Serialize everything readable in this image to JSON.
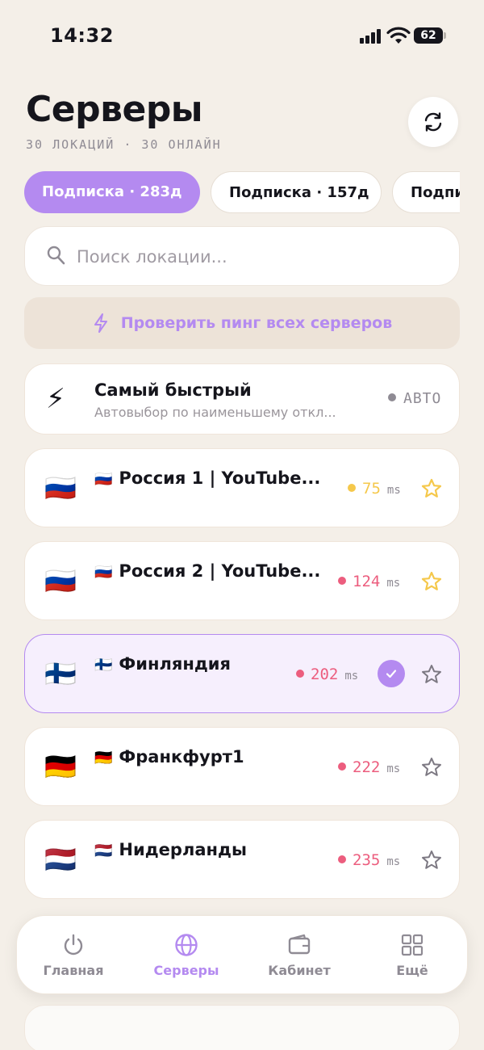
{
  "status_bar": {
    "time": "14:32",
    "battery": "62"
  },
  "header": {
    "title": "Серверы",
    "subtitle": "30 ЛОКАЦИЙ · 30 ОНЛАЙН"
  },
  "subscriptions": [
    {
      "label": "Подписка · 283д",
      "active": true
    },
    {
      "label": "Подписка · 157д",
      "active": false
    },
    {
      "label": "Подписка",
      "active": false
    }
  ],
  "search": {
    "placeholder": "Поиск локации...",
    "value": ""
  },
  "ping_all_label": "Проверить пинг всех серверов",
  "auto_server": {
    "title": "Самый быстрый",
    "description": "Автовыбор по наименьшему откл...",
    "badge": "АВТО",
    "icon": "⚡"
  },
  "servers": [
    {
      "flag": "🇷🇺",
      "name": "Россия 1 | YouTube...",
      "ping": "75",
      "unit": "ms",
      "ping_color": "#F5C84B",
      "favorite": true,
      "selected": false
    },
    {
      "flag": "🇷🇺",
      "name": "Россия 2 | YouTube...",
      "ping": "124",
      "unit": "ms",
      "ping_color": "#EC5D7E",
      "favorite": true,
      "selected": false
    },
    {
      "flag": "🇫🇮",
      "name": "Финляндия",
      "ping": "202",
      "unit": "ms",
      "ping_color": "#EC5D7E",
      "favorite": false,
      "selected": true
    },
    {
      "flag": "🇩🇪",
      "name": "Франкфурт1",
      "ping": "222",
      "unit": "ms",
      "ping_color": "#EC5D7E",
      "favorite": false,
      "selected": false
    },
    {
      "flag": "🇳🇱",
      "name": "Нидерланды",
      "ping": "235",
      "unit": "ms",
      "ping_color": "#EC5D7E",
      "favorite": false,
      "selected": false
    }
  ],
  "nav": [
    {
      "label": "Главная",
      "icon": "power-icon",
      "active": false
    },
    {
      "label": "Серверы",
      "icon": "globe-icon",
      "active": true
    },
    {
      "label": "Кабинет",
      "icon": "wallet-icon",
      "active": false
    },
    {
      "label": "Ещё",
      "icon": "grid-icon",
      "active": false
    }
  ],
  "colors": {
    "accent": "#B48AF0",
    "background": "#F4EFE8",
    "ping_good": "#F5C84B",
    "ping_bad": "#EC5D7E",
    "star_active": "#F5C84B",
    "muted": "#8F8B94"
  }
}
